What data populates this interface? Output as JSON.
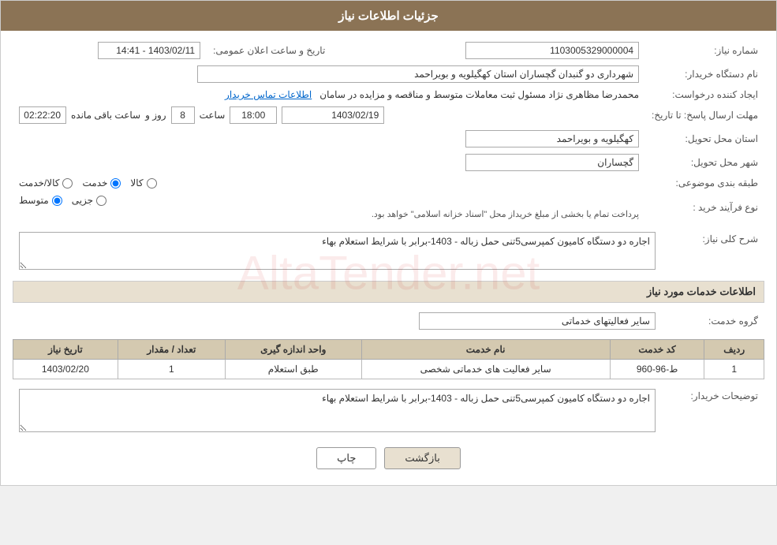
{
  "header": {
    "title": "جزئیات اطلاعات نیاز"
  },
  "fields": {
    "need_number_label": "شماره نیاز:",
    "need_number_value": "1103005329000004",
    "announce_date_label": "تاریخ و ساعت اعلان عمومی:",
    "announce_date_value": "1403/02/11 - 14:41",
    "buyer_label": "نام دستگاه خریدار:",
    "buyer_value": "شهرداری دو گنبدان گچساران استان کهگیلویه و بویراحمد",
    "creator_label": "ایجاد کننده درخواست:",
    "creator_value": "محمدرضا مظاهری نژاد مسئول ثبت معاملات متوسط و مناقصه و مزایده در سامان",
    "creator_link": "اطلاعات تماس خریدار",
    "deadline_label": "مهلت ارسال پاسخ: تا تاریخ:",
    "deadline_date": "1403/02/19",
    "deadline_time": "18:00",
    "deadline_days": "8",
    "deadline_remaining": "02:22:20",
    "deadline_remaining_label": "ساعت باقی مانده",
    "province_label": "استان محل تحویل:",
    "province_value": "کهگیلویه و بویراحمد",
    "city_label": "شهر محل تحویل:",
    "city_value": "گچساران",
    "category_label": "طبقه بندی موضوعی:",
    "category_options": [
      "کالا",
      "خدمت",
      "کالا/خدمت"
    ],
    "category_selected": "خدمت",
    "purchase_type_label": "نوع فرآیند خرید :",
    "purchase_type_options": [
      "جزیی",
      "متوسط"
    ],
    "purchase_type_selected": "متوسط",
    "purchase_type_note": "پرداخت تمام یا بخشی از مبلغ خریداز محل \"اسناد خزانه اسلامی\" خواهد بود.",
    "general_desc_label": "شرح کلی نیاز:",
    "general_desc_value": "اجاره دو دستگاه کامیون کمپرسی5تنی حمل زباله - 1403-برابر با شرایط استعلام بهاء",
    "services_section": "اطلاعات خدمات مورد نیاز",
    "service_group_label": "گروه خدمت:",
    "service_group_value": "سایر فعالیتهای خدماتی",
    "table": {
      "columns": [
        "ردیف",
        "کد خدمت",
        "نام خدمت",
        "واحد اندازه گیری",
        "تعداد / مقدار",
        "تاریخ نیاز"
      ],
      "rows": [
        {
          "row": "1",
          "code": "ط-96-960",
          "name": "سایر فعالیت های خدماتی شخصی",
          "unit": "طبق استعلام",
          "qty": "1",
          "date": "1403/02/20"
        }
      ]
    },
    "buyer_desc_label": "توضیحات خریدار:",
    "buyer_desc_value": "اجاره دو دستگاه کامیون کمپرسی5تنی حمل زباله - 1403-برابر با شرایط استعلام بهاء"
  },
  "buttons": {
    "print_label": "چاپ",
    "back_label": "بازگشت"
  }
}
